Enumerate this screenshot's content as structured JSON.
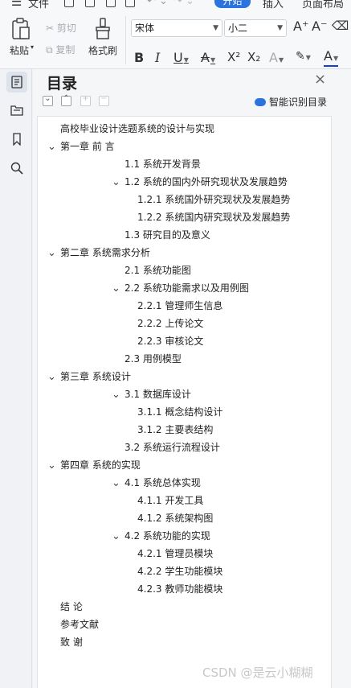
{
  "menu": {
    "file": "文件",
    "start_tab": "开始",
    "insert_tab": "插入",
    "layout_tab": "页面布局"
  },
  "ribbon": {
    "paste": "粘贴",
    "cut": "剪切",
    "copy": "复制",
    "format_painter": "格式刷",
    "font_name": "宋体",
    "font_size": "小二",
    "bold": "B",
    "italic": "I",
    "underline": "U",
    "strike": "A",
    "superscript": "X²",
    "subscript": "X₂",
    "font_color_letter": "A",
    "grow_font": "A⁺",
    "shrink_font": "A⁻"
  },
  "panel": {
    "title": "目录",
    "close": "×",
    "collapse_all": "−",
    "expand_all": "^",
    "add": "+",
    "remove": "−",
    "smart_label": "智能识别目录"
  },
  "toc": [
    {
      "text": "高校毕业设计选题系统的设计与实现",
      "level": 0,
      "chevron": false
    },
    {
      "text": "第一章  前    言",
      "level": 0,
      "chevron": true
    },
    {
      "text": "1.1  系统开发背景",
      "level": 1,
      "chevron": false
    },
    {
      "text": "1.2  系统的国内外研究现状及发展趋势",
      "level": 1,
      "chevron": true
    },
    {
      "text": "1.2.1  系统国外研究现状及发展趋势",
      "level": 2,
      "chevron": false
    },
    {
      "text": "1.2.2  系统国内研究现状及发展趋势",
      "level": 2,
      "chevron": false
    },
    {
      "text": "1.3  研究目的及意义",
      "level": 1,
      "chevron": false
    },
    {
      "text": "第二章  系统需求分析",
      "level": 0,
      "chevron": true
    },
    {
      "text": "2.1  系统功能图",
      "level": 1,
      "chevron": false
    },
    {
      "text": "2.2  系统功能需求以及用例图",
      "level": 1,
      "chevron": true
    },
    {
      "text": "2.2.1 管理师生信息",
      "level": 2,
      "chevron": false
    },
    {
      "text": "2.2.2 上传论文",
      "level": 2,
      "chevron": false
    },
    {
      "text": "2.2.3 审核论文",
      "level": 2,
      "chevron": false
    },
    {
      "text": "2.3  用例模型",
      "level": 1,
      "chevron": false
    },
    {
      "text": "第三章  系统设计",
      "level": 0,
      "chevron": true
    },
    {
      "text": "3.1  数据库设计",
      "level": 1,
      "chevron": true
    },
    {
      "text": "3.1.1  概念结构设计",
      "level": 2,
      "chevron": false
    },
    {
      "text": "3.1.2  主要表结构",
      "level": 2,
      "chevron": false
    },
    {
      "text": "3.2  系统运行流程设计",
      "level": 1,
      "chevron": false
    },
    {
      "text": "第四章  系统的实现",
      "level": 0,
      "chevron": true
    },
    {
      "text": "4.1 系统总体实现",
      "level": 1,
      "chevron": true
    },
    {
      "text": "4.1.1 开发工具",
      "level": 2,
      "chevron": false
    },
    {
      "text": "4.1.2  系统架构图",
      "level": 2,
      "chevron": false
    },
    {
      "text": "4.2  系统功能的实现",
      "level": 1,
      "chevron": true
    },
    {
      "text": "4.2.1  管理员模块",
      "level": 2,
      "chevron": false
    },
    {
      "text": "4.2.2  学生功能模块",
      "level": 2,
      "chevron": false
    },
    {
      "text": "4.2.3  教师功能模块",
      "level": 2,
      "chevron": false
    },
    {
      "text": "结    论",
      "level": 0,
      "chevron": false
    },
    {
      "text": "参考文献",
      "level": 0,
      "chevron": false
    },
    {
      "text": "致  谢",
      "level": 0,
      "chevron": false
    }
  ],
  "watermark": "CSDN @是云小糊糊",
  "colors": {
    "accent": "#2b74e0",
    "panel_bg": "#f5f6f8",
    "ribbon_bg": "#f7f8fa"
  }
}
